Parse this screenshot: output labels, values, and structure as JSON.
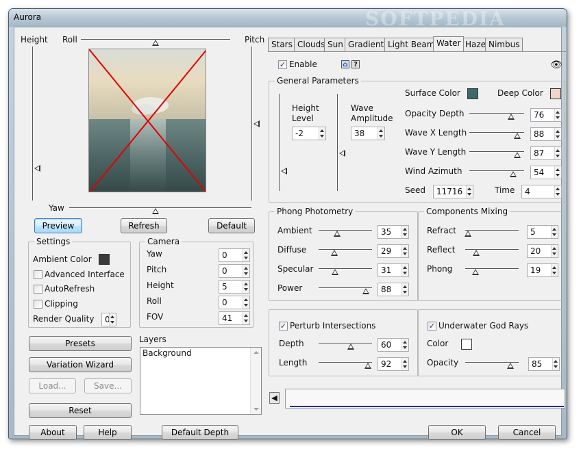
{
  "window": {
    "title": "Aurora",
    "watermark": "SOFTPEDIA"
  },
  "preview": {
    "labels": {
      "height": "Height",
      "roll": "Roll",
      "pitch": "Pitch",
      "yaw": "Yaw"
    },
    "buttons": {
      "preview": "Preview",
      "refresh": "Refresh",
      "default": "Default"
    }
  },
  "settings": {
    "title": "Settings",
    "ambient_color_label": "Ambient Color",
    "ambient_color": "#3a3a3a",
    "advanced_interface": "Advanced Interface",
    "auto_refresh": "AutoRefresh",
    "clipping": "Clipping",
    "render_quality_label": "Render Quality",
    "render_quality": "0"
  },
  "camera": {
    "title": "Camera",
    "fields": [
      {
        "label": "Yaw",
        "value": "0"
      },
      {
        "label": "Pitch",
        "value": "0"
      },
      {
        "label": "Height",
        "value": "5"
      },
      {
        "label": "Roll",
        "value": "0"
      },
      {
        "label": "FOV",
        "value": "41"
      }
    ]
  },
  "left_buttons": {
    "presets": "Presets",
    "variation_wizard": "Variation Wizard",
    "load": "Load...",
    "save": "Save...",
    "reset": "Reset"
  },
  "layers": {
    "title": "Layers",
    "items": [
      "Background"
    ]
  },
  "footer": {
    "about": "About",
    "help": "Help",
    "default_depth": "Default Depth",
    "ok": "OK",
    "cancel": "Cancel"
  },
  "tabs": [
    "Stars",
    "Clouds",
    "Sun",
    "Gradient",
    "Light Beams",
    "Water",
    "Haze",
    "Nimbus"
  ],
  "active_tab": "Water",
  "enable_label": "Enable",
  "general": {
    "title": "General Parameters",
    "height_level_label": "Height\nLevel",
    "height_level": "-2",
    "wave_amplitude_label": "Wave\nAmplitude",
    "wave_amplitude": "38",
    "surface_color_label": "Surface Color",
    "surface_color": "#3b6a6c",
    "deep_color_label": "Deep Color",
    "deep_color": "#f4d3c8",
    "sliders": [
      {
        "label": "Opacity Depth",
        "value": "76",
        "level": 0.76
      },
      {
        "label": "Wave X Length",
        "value": "88",
        "level": 0.88
      },
      {
        "label": "Wave Y Length",
        "value": "87",
        "level": 0.87
      },
      {
        "label": "Wind Azimuth",
        "value": "54",
        "level": 0.8
      }
    ],
    "seed_label": "Seed",
    "seed": "11716",
    "time_label": "Time",
    "time": "4"
  },
  "phong": {
    "title": "Phong Photometry",
    "sliders": [
      {
        "label": "Ambient",
        "value": "35",
        "level": 0.35
      },
      {
        "label": "Diffuse",
        "value": "29",
        "level": 0.29
      },
      {
        "label": "Specular",
        "value": "31",
        "level": 0.31
      },
      {
        "label": "Power",
        "value": "88",
        "level": 0.88
      }
    ]
  },
  "mixing": {
    "title": "Components Mixing",
    "sliders": [
      {
        "label": "Refract",
        "value": "5",
        "level": 0.05
      },
      {
        "label": "Reflect",
        "value": "20",
        "level": 0.2
      },
      {
        "label": "Phong",
        "value": "19",
        "level": 0.19
      }
    ]
  },
  "perturb": {
    "label": "Perturb Intersections",
    "sliders": [
      {
        "label": "Depth",
        "value": "60",
        "level": 0.6
      },
      {
        "label": "Length",
        "value": "92",
        "level": 0.92
      }
    ]
  },
  "godrays": {
    "label": "Underwater God Rays",
    "color_label": "Color",
    "color": "#ffffff",
    "opacity_label": "Opacity",
    "opacity": "85",
    "opacity_level": 0.85
  }
}
